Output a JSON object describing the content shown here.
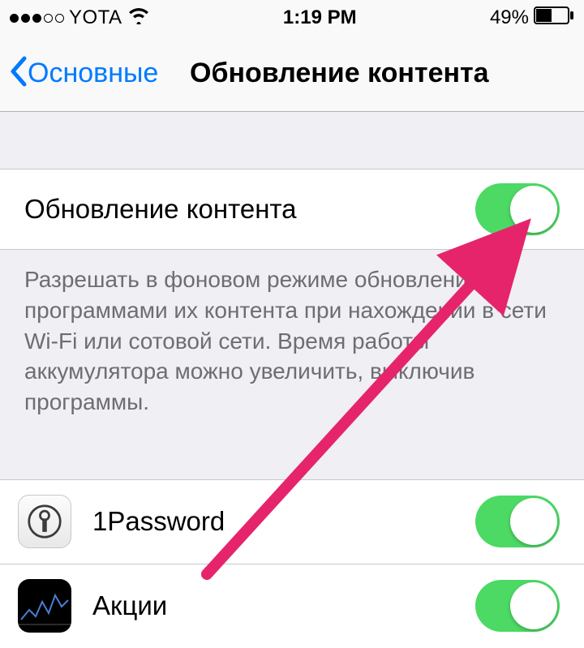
{
  "status_bar": {
    "carrier": "YOTA",
    "time": "1:19 PM",
    "battery_pct": "49%"
  },
  "nav": {
    "back_label": "Основные",
    "title": "Обновление контента"
  },
  "main_toggle": {
    "label": "Обновление контента",
    "on": true
  },
  "description": "Разрешать в фоновом режиме обновление программами их контента при нахождении в сети Wi-Fi или сотовой сети. Время работы аккумулятора можно увеличить, выключив программы.",
  "apps": [
    {
      "name": "1Password",
      "on": true
    },
    {
      "name": "Акции",
      "on": true
    }
  ],
  "colors": {
    "tint": "#007aff",
    "toggle_on": "#4cd964",
    "bg": "#efeff4",
    "annotation": "#e6246b"
  }
}
